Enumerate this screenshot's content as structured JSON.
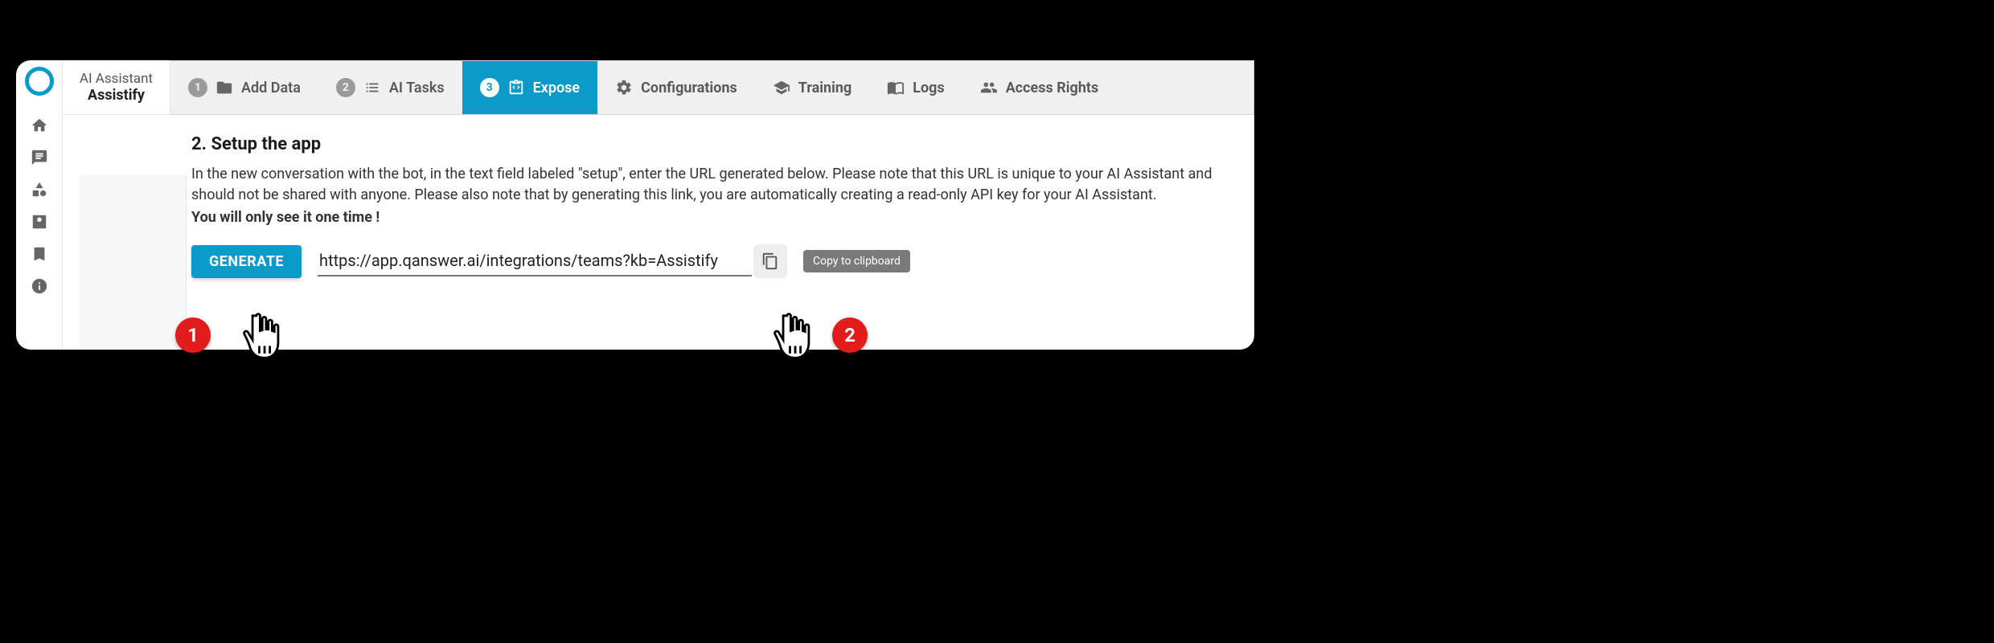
{
  "header": {
    "line1": "AI Assistant",
    "line2": "Assistify"
  },
  "tabs": {
    "step1": {
      "num": "1",
      "label": "Add Data"
    },
    "step2": {
      "num": "2",
      "label": "AI Tasks"
    },
    "step3": {
      "num": "3",
      "label": "Expose"
    },
    "configurations": "Configurations",
    "training": "Training",
    "logs": "Logs",
    "access": "Access Rights"
  },
  "section": {
    "heading": "2. Setup the app",
    "paragraph": "In the new conversation with the bot, in the text field labeled \"setup\", enter the URL generated below. Please note that this URL is unique to your AI Assistant and should not be shared with anyone. Please also note that by generating this link, you are automatically creating a read-only API key for your AI Assistant.",
    "emphasis": "You will only see it one time !",
    "generate_label": "GENERATE",
    "url_value": "https://app.qanswer.ai/integrations/teams?kb=Assistify",
    "tooltip": "Copy to clipboard"
  },
  "annotations": {
    "badge1": "1",
    "badge2": "2"
  }
}
